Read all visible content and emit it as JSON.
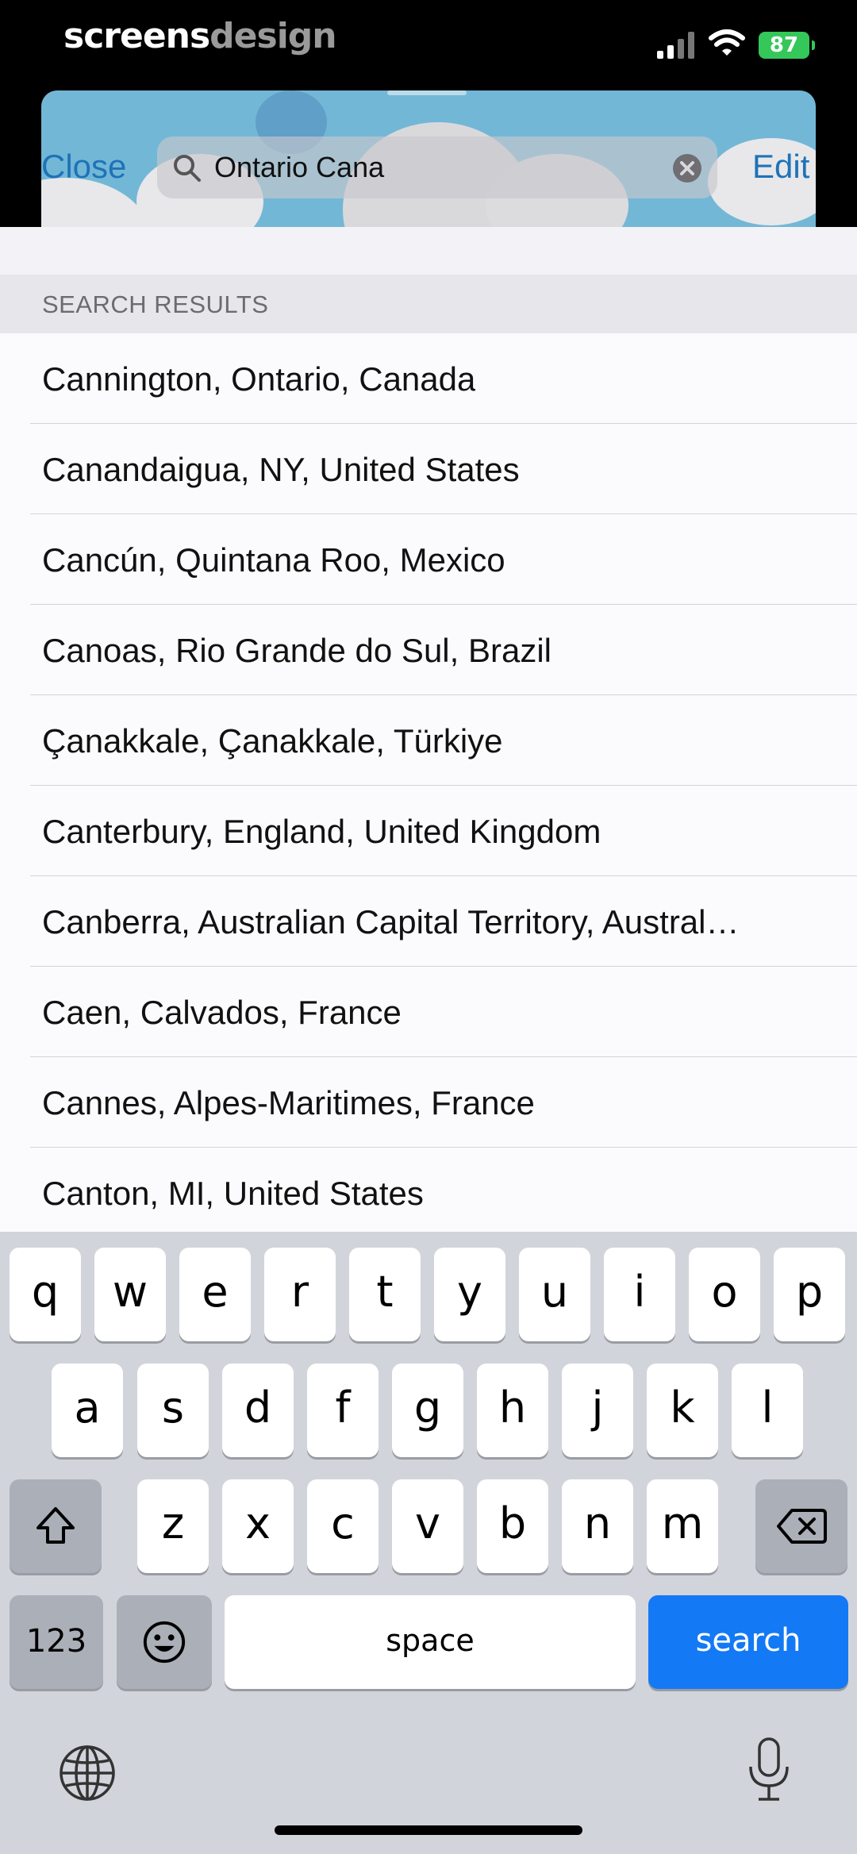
{
  "status_bar": {
    "brand_part1": "screens",
    "brand_part2": "design",
    "battery": "87"
  },
  "header": {
    "close_label": "Close",
    "edit_label": "Edit",
    "search_value": "Ontario Cana"
  },
  "results": {
    "section_title": "SEARCH RESULTS",
    "items": [
      "Cannington, Ontario, Canada",
      "Canandaigua, NY, United States",
      "Cancún, Quintana Roo, Mexico",
      "Canoas, Rio Grande do Sul, Brazil",
      "Çanakkale, Çanakkale, Türkiye",
      "Canterbury, England, United Kingdom",
      "Canberra, Australian Capital Territory, Austral…",
      "Caen, Calvados, France",
      "Cannes, Alpes-Maritimes, France",
      "Canton, MI, United States"
    ]
  },
  "keyboard": {
    "row1": [
      "q",
      "w",
      "e",
      "r",
      "t",
      "y",
      "u",
      "i",
      "o",
      "p"
    ],
    "row2": [
      "a",
      "s",
      "d",
      "f",
      "g",
      "h",
      "j",
      "k",
      "l"
    ],
    "row3": [
      "z",
      "x",
      "c",
      "v",
      "b",
      "n",
      "m"
    ],
    "numbers_label": "123",
    "space_label": "space",
    "search_label": "search"
  },
  "colors": {
    "accent": "#1e73b8",
    "search_key": "#1479f5",
    "battery": "#35c759"
  }
}
